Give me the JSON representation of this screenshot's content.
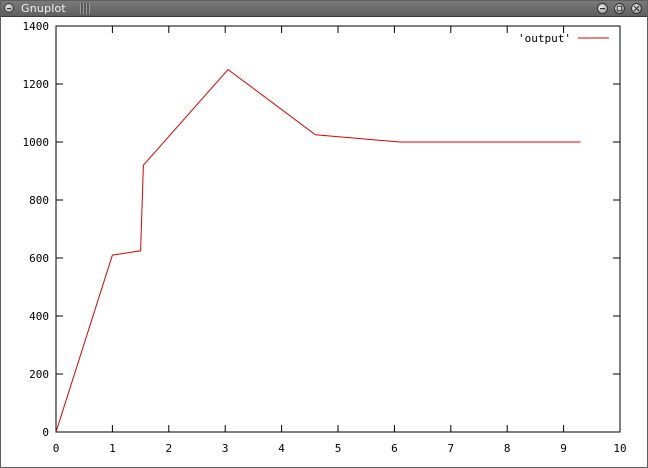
{
  "window": {
    "title": "Gnuplot",
    "controls": [
      "minimize-icon",
      "maximize-icon",
      "close-icon"
    ]
  },
  "chart_data": {
    "type": "line",
    "series": [
      {
        "name": "'output'",
        "color": "#e00000",
        "x": [
          0,
          1.0,
          1.5,
          1.55,
          3.05,
          4.6,
          6.1,
          9.3
        ],
        "y": [
          0,
          610,
          625,
          920,
          1250,
          1025,
          1000,
          1000
        ]
      }
    ],
    "xlim": [
      0,
      10
    ],
    "ylim": [
      0,
      1400
    ],
    "xticks": [
      "0",
      "1",
      "2",
      "3",
      "4",
      "5",
      "6",
      "7",
      "8",
      "9",
      "10"
    ],
    "yticks": [
      "0",
      "200",
      "400",
      "600",
      "800",
      "1000",
      "1200",
      "1400"
    ],
    "grid": false,
    "legend": "top-right"
  }
}
